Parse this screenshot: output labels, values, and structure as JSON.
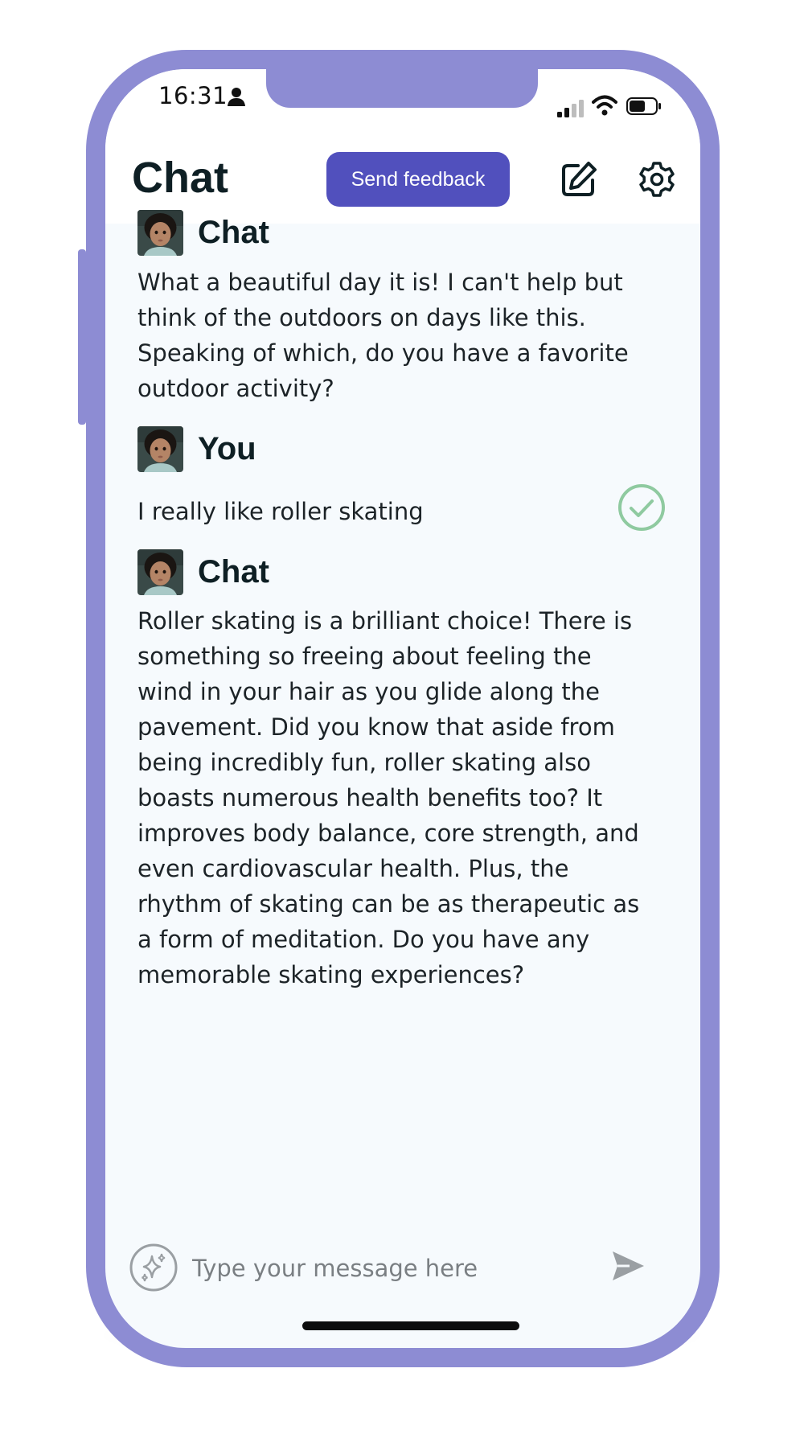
{
  "status_bar": {
    "time": "16:31",
    "icons": [
      "person-icon",
      "cellular-signal-icon",
      "wifi-icon",
      "battery-icon"
    ]
  },
  "header": {
    "title": "Chat",
    "feedback_button": "Send feedback",
    "edit_icon": "edit-icon",
    "settings_icon": "gear-icon"
  },
  "messages": [
    {
      "author": "Chat",
      "text": "What a beautiful day it is! I can't help but think of the outdoors on days like this. Speaking of which, do you have a favorite outdoor activity?"
    },
    {
      "author": "You",
      "text": "I really like roller skating",
      "status_icon": "check-circle-icon"
    },
    {
      "author": "Chat",
      "text": "Roller skating is a brilliant choice! There is something so freeing about feeling the wind in your hair as you glide along the pavement. Did you know that aside from being incredibly fun, roller skating also boasts numerous health benefits too? It improves body balance, core strength, and even cardiovascular health. Plus, the rhythm of skating can be as therapeutic as a form of meditation. Do you have any memorable skating experiences?"
    }
  ],
  "composer": {
    "placeholder": "Type your message here",
    "value": "",
    "sparkle_icon": "sparkle-icon",
    "send_icon": "send-icon"
  },
  "colors": {
    "frame": "#8d8cd3",
    "accent": "#5150bd",
    "background": "#f6fafd",
    "check": "#8fcaa0"
  }
}
